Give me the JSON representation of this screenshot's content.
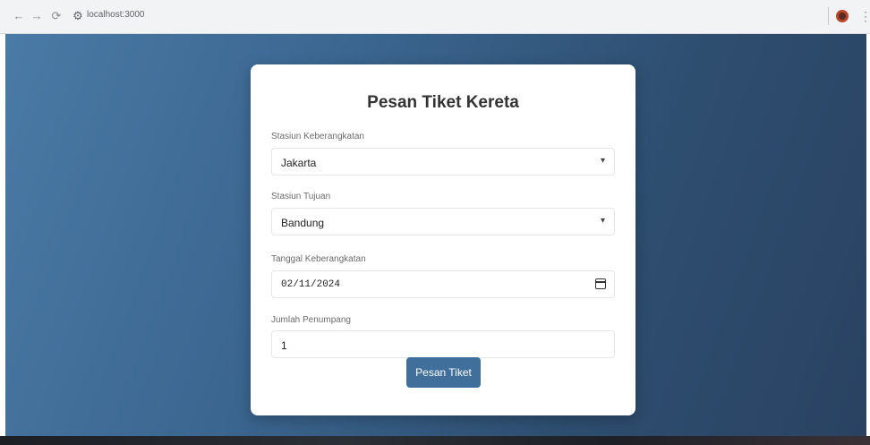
{
  "browser": {
    "back_icon": "arrow-left-icon",
    "forward_icon": "arrow-right-icon",
    "reload_icon": "reload-icon",
    "site_info_icon": "site-info-icon",
    "address": "localhost:3000",
    "profile_icon": "profile-icon",
    "menu_icon": "kebab-menu-icon"
  },
  "form": {
    "title": "Pesan Tiket Kereta",
    "departure_label": "Stasiun Keberangkatan",
    "departure_value": "Jakarta",
    "destination_label": "Stasiun Tujuan",
    "destination_value": "Bandung",
    "date_label": "Tanggal Keberangkatan",
    "date_value": "02/11/2024",
    "passengers_label": "Jumlah Penumpang",
    "passengers_value": "1",
    "submit_label": "Pesan Tiket"
  },
  "colors": {
    "button": "#3f6f9a",
    "background_gradient_start": "#4a7aa6",
    "background_gradient_end": "#2a4262"
  }
}
